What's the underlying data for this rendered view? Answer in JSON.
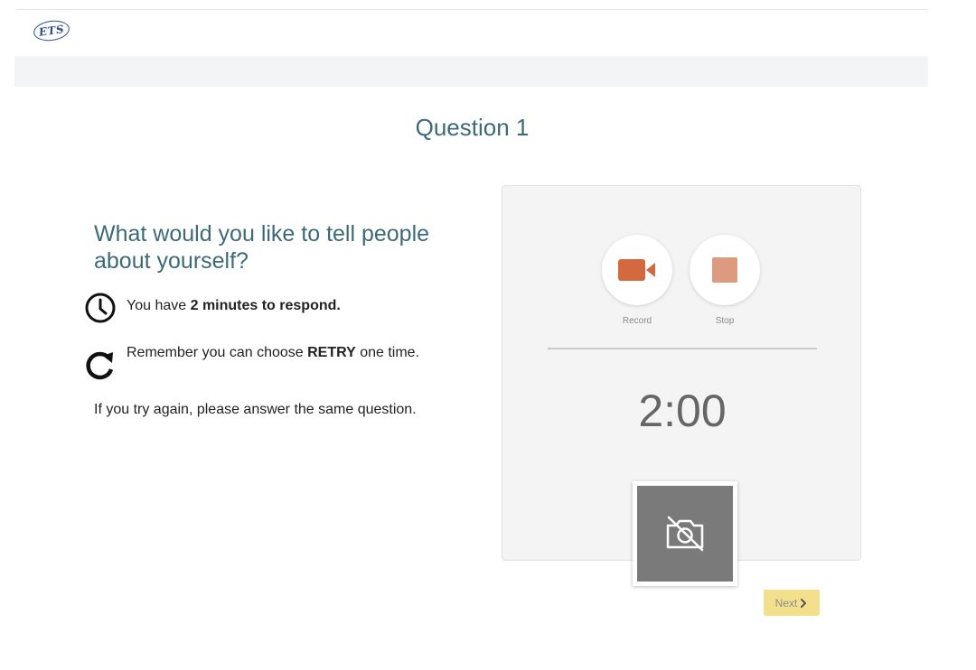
{
  "header": {
    "logo_text": "ETS"
  },
  "question": {
    "title": "Question 1",
    "prompt": "What would you like to tell people about yourself?"
  },
  "instructions": {
    "time_prefix": "You have ",
    "time_bold": "2 minutes to respond.",
    "retry_prefix": "Remember you can choose ",
    "retry_bold": "RETRY",
    "retry_suffix": " one time.",
    "note": "If you try again, please answer the same question."
  },
  "recorder": {
    "record_label": "Record",
    "stop_label": "Stop",
    "timer": "2:00"
  },
  "footer": {
    "next_label": "Next"
  },
  "icons": {
    "clock": "clock-icon",
    "retry": "retry-icon",
    "record": "video-camera-icon",
    "stop": "stop-icon",
    "camera_off": "camera-off-icon",
    "next": "chevron-right-icon"
  },
  "colors": {
    "heading": "#3c6a78",
    "record_accent": "#d4683f",
    "stop_accent": "#dc9a7f",
    "next_button": "#f2e08c",
    "camera_bg": "#7a7a7a"
  }
}
